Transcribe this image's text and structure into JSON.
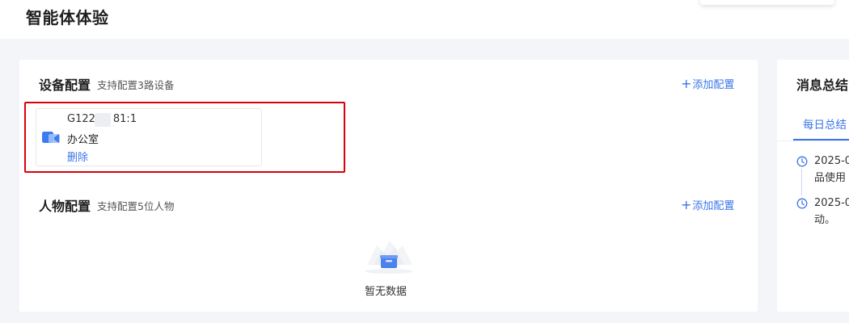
{
  "page": {
    "title": "智能体体验"
  },
  "device_section": {
    "title": "设备配置",
    "subtitle": "支持配置3路设备",
    "add_label": "添加配置",
    "devices": [
      {
        "id_prefix": "G122",
        "id_suffix": "81:1",
        "name": "办公室",
        "delete_label": "删除",
        "icon": "video-camera-icon"
      }
    ],
    "highlight_color": "#d9000b"
  },
  "person_section": {
    "title": "人物配置",
    "subtitle": "支持配置5位人物",
    "add_label": "添加配置",
    "empty_text": "暂无数据",
    "empty_icon": "empty-box-illustration"
  },
  "message_panel": {
    "title": "消息总结",
    "active_tab": "每日总结",
    "entries": [
      {
        "line1": "2025-0",
        "line2": "品使用",
        "icon": "clock-icon"
      },
      {
        "line1": "2025-0",
        "line2": "动。",
        "icon": "clock-icon"
      }
    ]
  },
  "colors": {
    "accent": "#3a75e8",
    "background": "#f4f5f9",
    "panel": "#ffffff"
  }
}
